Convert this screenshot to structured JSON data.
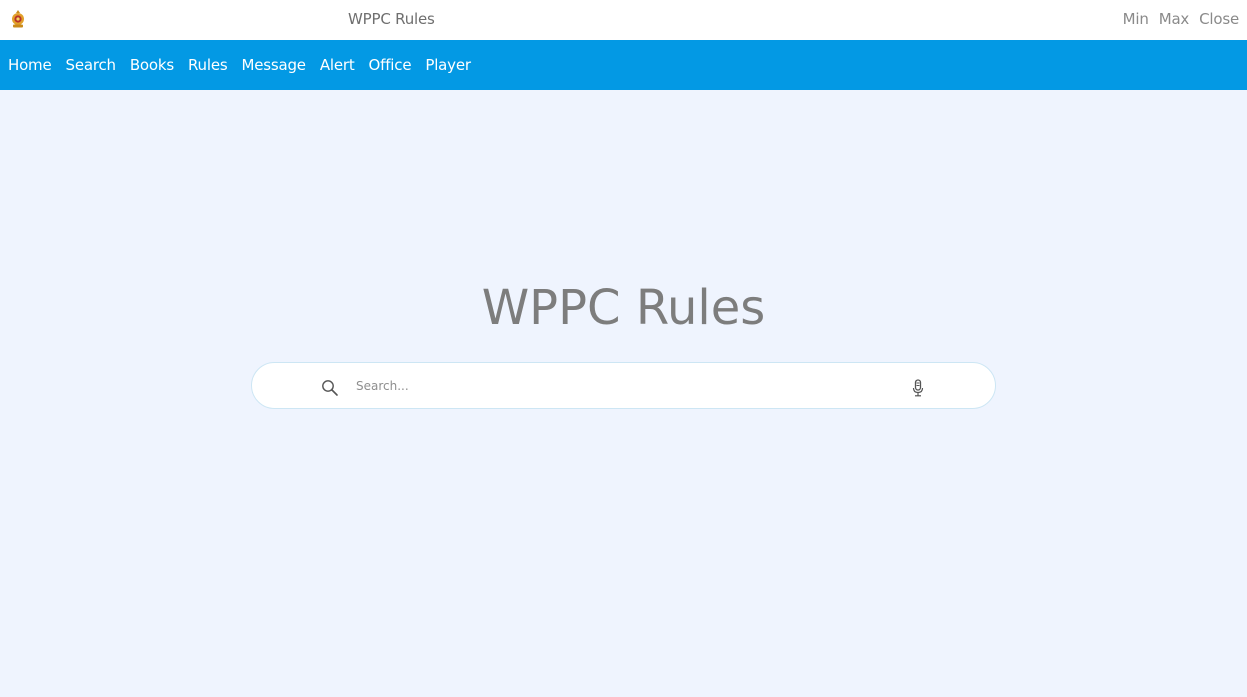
{
  "window": {
    "title": "WPPC Rules",
    "controls": {
      "min": "Min",
      "max": "Max",
      "close": "Close"
    },
    "logo_icon": "emblem-icon"
  },
  "nav": {
    "items": [
      {
        "label": "Home"
      },
      {
        "label": "Search"
      },
      {
        "label": "Books"
      },
      {
        "label": "Rules"
      },
      {
        "label": "Message"
      },
      {
        "label": "Alert"
      },
      {
        "label": "Office"
      },
      {
        "label": "Player"
      }
    ]
  },
  "main": {
    "title": "WPPC Rules",
    "search": {
      "placeholder": "Search...",
      "value": "",
      "left_icon": "search-icon",
      "right_icon": "microphone-icon"
    }
  },
  "colors": {
    "nav_background": "#0399e4",
    "page_background": "#eff4fe",
    "title_text": "#7d7d7d"
  }
}
